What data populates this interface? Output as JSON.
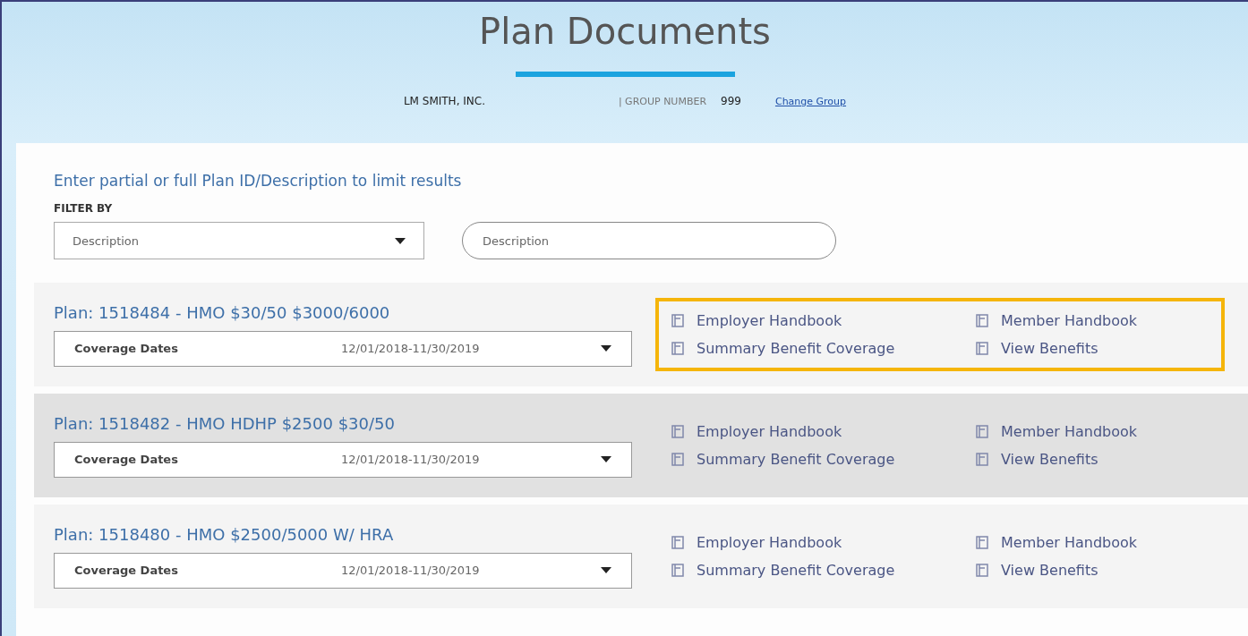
{
  "header": {
    "title": "Plan Documents",
    "company": "LM SMITH, INC.",
    "group_label": "| GROUP NUMBER",
    "group_number": "999",
    "change_link": "Change Group"
  },
  "filter": {
    "hint": "Enter partial or full Plan ID/Description to limit results",
    "label": "FILTER BY",
    "select_value": "Description",
    "search_placeholder": "Description"
  },
  "plans": [
    {
      "title": "Plan: 1518484 - HMO $30/50 $3000/6000",
      "dates_label": "Coverage Dates",
      "dates": "12/01/2018-11/30/2019",
      "selected": false,
      "highlighted": true,
      "documents": [
        "Employer Handbook",
        "Member Handbook",
        "Summary Benefit Coverage",
        "View Benefits"
      ]
    },
    {
      "title": "Plan: 1518482 - HMO HDHP $2500 $30/50",
      "dates_label": "Coverage Dates",
      "dates": "12/01/2018-11/30/2019",
      "selected": true,
      "highlighted": false,
      "documents": [
        "Employer Handbook",
        "Member Handbook",
        "Summary Benefit Coverage",
        "View Benefits"
      ]
    },
    {
      "title": "Plan: 1518480 - HMO $2500/5000 W/ HRA",
      "dates_label": "Coverage Dates",
      "dates": "12/01/2018-11/30/2019",
      "selected": false,
      "highlighted": false,
      "documents": [
        "Employer Handbook",
        "Member Handbook",
        "Summary Benefit Coverage",
        "View Benefits"
      ]
    }
  ]
}
